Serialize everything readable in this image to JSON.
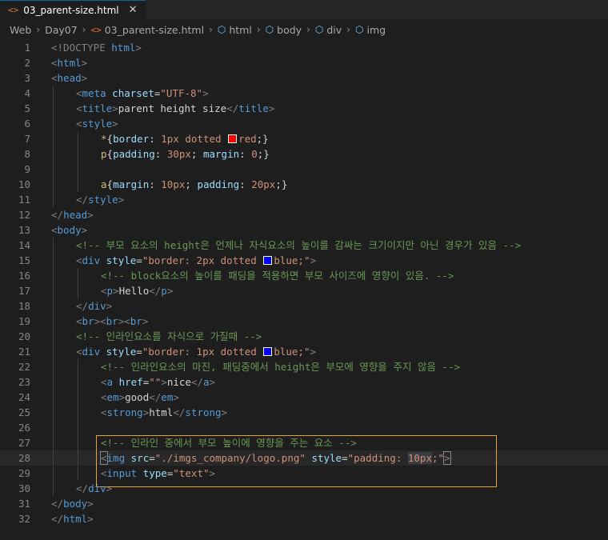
{
  "tab": {
    "icon": "<>",
    "filename": "03_parent-size.html",
    "close": "✕"
  },
  "breadcrumb": {
    "items": [
      "Web",
      "Day07",
      "03_parent-size.html",
      "html",
      "body",
      "div",
      "img"
    ]
  },
  "code": {
    "l1": [
      "<!DOCTYPE ",
      "html",
      ">"
    ],
    "html": "html",
    "head": "head",
    "meta": "meta",
    "charset": "charset",
    "utf8": "\"UTF-8\"",
    "title": "title",
    "title_text": "parent height size",
    "style": "style",
    "l7_sel": "*",
    "l7_prop": "border",
    "l7_val1": "1px dotted ",
    "l7_val2": "red",
    "l7_end": ";}",
    "l8_sel": "p",
    "l8_prop1": "padding",
    "l8_val1": "30px",
    "l8_prop2": "margin",
    "l8_val2": "0",
    "l8_end": ";}",
    "l10_sel": "a",
    "l10_prop1": "margin",
    "l10_val1": "10px",
    "l10_prop2": "padding",
    "l10_val2": "20px",
    "l10_end": ";}",
    "body": "body",
    "c14": "<!-- 부모 요소의 height은 언제나 자식요소의 높이를 감싸는 크기이지만 아닌 경우가 있음 -->",
    "div": "div",
    "style_attr": "style",
    "l15_val_a": "\"border: 2px dotted ",
    "l15_val_b": "blue;\"",
    "c16": "<!-- block요소의 높이를 패딩을 적용하면 부모 사이즈에 영향이 있음. -->",
    "p": "p",
    "hello": "Hello",
    "br": "br",
    "c20": "<!-- 인라인요소를 자식으로 가질때 -->",
    "l21_val_a": "\"border: 1px dotted ",
    "l21_val_b": "blue;\"",
    "c22": "<!-- 인라인요소의 마진, 패딩중에서 height은 부모에 영향을 주지 않음 -->",
    "a": "a",
    "href": "href",
    "href_val": "\"\"",
    "nice": "nice",
    "em": "em",
    "good": "good",
    "strong": "strong",
    "html_text": "html",
    "c27": "<!-- 인라인 중에서 부모 높이에 영향을 주는 요소 -->",
    "img": "img",
    "src": "src",
    "src_val": "\"./imgs_company/logo.png\"",
    "style28_a": "\"padding: ",
    "style28_b": "10px",
    "style28_c": ";\"",
    "input": "input",
    "type": "type",
    "type_val": "\"text\""
  },
  "line_numbers": [
    "1",
    "2",
    "3",
    "4",
    "5",
    "6",
    "7",
    "8",
    "9",
    "10",
    "11",
    "12",
    "13",
    "14",
    "15",
    "16",
    "17",
    "18",
    "19",
    "20",
    "21",
    "22",
    "23",
    "24",
    "25",
    "26",
    "27",
    "28",
    "29",
    "30",
    "31",
    "32"
  ],
  "colors": {
    "background": "#1e1e1e",
    "tag": "#569cd6",
    "attribute": "#9cdcfe",
    "string": "#ce9178",
    "comment": "#6a9955",
    "highlight_box": "#e8a23a"
  }
}
